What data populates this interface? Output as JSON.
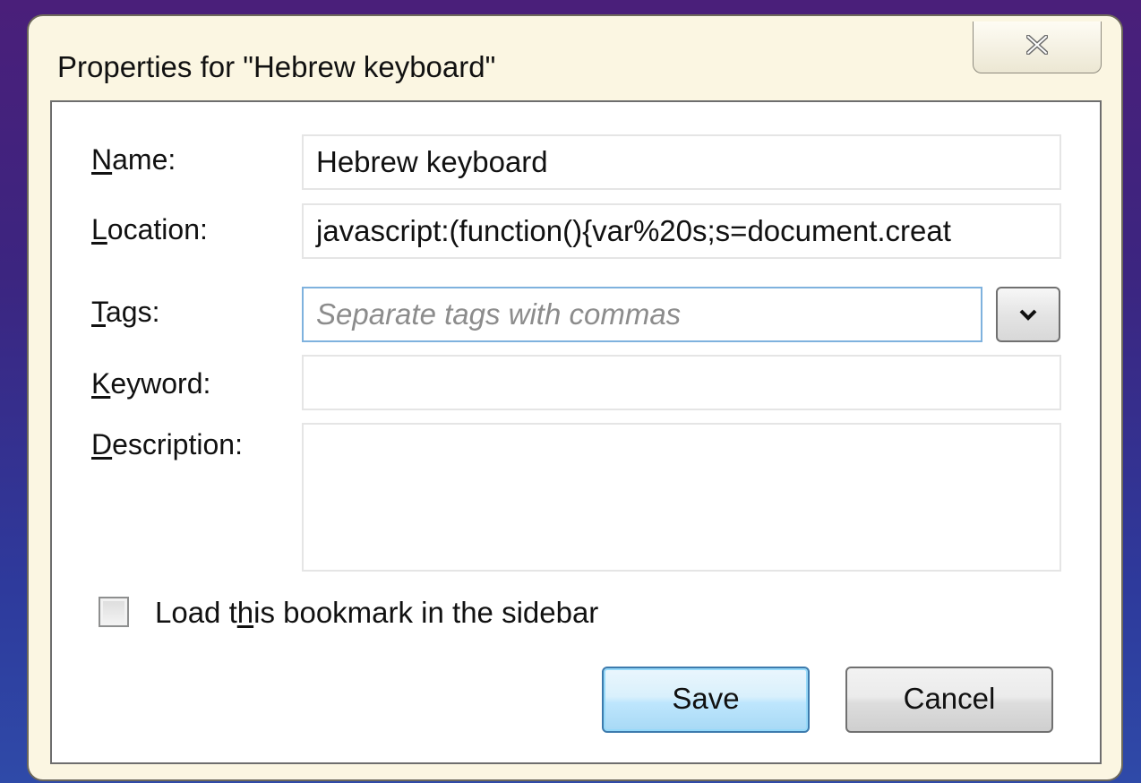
{
  "dialog": {
    "title": "Properties for \"Hebrew keyboard\"",
    "close_icon": "close-icon"
  },
  "form": {
    "name_label": "Name:",
    "name_value": "Hebrew keyboard",
    "location_label": "Location:",
    "location_value": "javascript:(function(){var%20s;s=document.creat",
    "tags_label": "Tags:",
    "tags_placeholder": "Separate tags with commas",
    "tags_value": "",
    "tags_dropdown_icon": "chevron-down-icon",
    "keyword_label": "Keyword:",
    "keyword_value": "",
    "description_label": "Description:",
    "description_value": "",
    "sidebar_checkbox_label": "Load this bookmark in the sidebar",
    "sidebar_checkbox_checked": false
  },
  "buttons": {
    "save_label": "Save",
    "cancel_label": "Cancel"
  }
}
